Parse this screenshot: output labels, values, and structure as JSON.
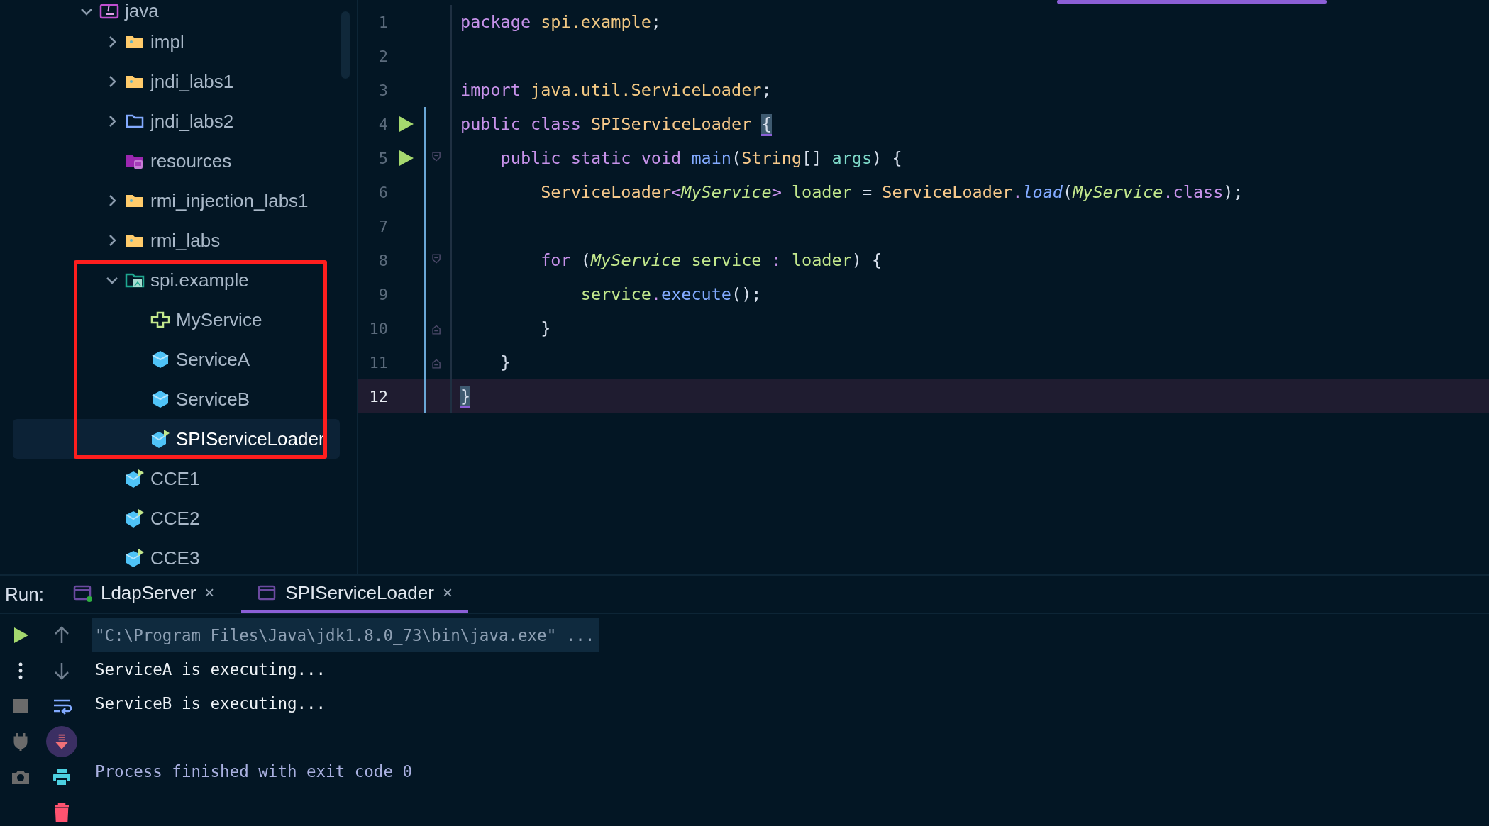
{
  "project_tree": {
    "items": [
      {
        "label": "java",
        "kind": "java-root",
        "expanded": true,
        "children": [
          {
            "label": "impl",
            "kind": "folder",
            "expanded": false
          },
          {
            "label": "jndi_labs1",
            "kind": "folder",
            "expanded": false
          },
          {
            "label": "jndi_labs2",
            "kind": "source-folder",
            "expanded": false
          },
          {
            "label": "resources",
            "kind": "resources"
          },
          {
            "label": "rmi_injection_labs1",
            "kind": "folder",
            "expanded": false
          },
          {
            "label": "rmi_labs",
            "kind": "folder",
            "expanded": false
          },
          {
            "label": "spi.example",
            "kind": "package",
            "expanded": true,
            "highlighted": true,
            "children": [
              {
                "label": "MyService",
                "kind": "interface",
                "selected": false
              },
              {
                "label": "ServiceA",
                "kind": "class",
                "selected": false
              },
              {
                "label": "ServiceB",
                "kind": "class",
                "selected": false
              },
              {
                "label": "SPIServiceLoader",
                "kind": "main-class",
                "selected": true
              }
            ]
          },
          {
            "label": "CCE1",
            "kind": "main-class",
            "selected": false
          },
          {
            "label": "CCE2",
            "kind": "main-class",
            "selected": false
          },
          {
            "label": "CCE3",
            "kind": "main-class",
            "selected": false
          }
        ]
      }
    ]
  },
  "editor": {
    "lines": [
      {
        "number": "1",
        "changed": false,
        "current": false,
        "tokens": [
          {
            "t": "package",
            "kind": "kw"
          },
          {
            "t": " spi.example",
            "kind": "pkg"
          },
          {
            "t": ";",
            "kind": "p"
          }
        ]
      },
      {
        "number": "2",
        "changed": false,
        "current": false
      },
      {
        "number": "3",
        "changed": false,
        "current": false,
        "tokens": [
          {
            "t": "import",
            "kind": "kw"
          },
          {
            "t": " java.util.ServiceLoader",
            "kind": "pkg"
          },
          {
            "t": ";",
            "kind": "p"
          }
        ]
      },
      {
        "number": "4",
        "changed": true,
        "current": false,
        "gutter": [
          {
            "kind": "run"
          }
        ],
        "tokens": [
          {
            "t": "public class",
            "kind": "kw"
          },
          {
            "t": " SPIServiceLoader ",
            "kind": "cls"
          },
          {
            "t": "{",
            "kind": "p",
            "matched": true
          }
        ]
      },
      {
        "number": "5",
        "changed": true,
        "current": false,
        "gutter": [
          {
            "kind": "run"
          },
          {
            "kind": "fold-start"
          }
        ],
        "tokens": [
          {
            "t": "    public static void",
            "kind": "kw"
          },
          {
            "t": " main",
            "kind": "fn"
          },
          {
            "t": "(",
            "kind": "p"
          },
          {
            "t": "String",
            "kind": "cls"
          },
          {
            "t": "[] ",
            "kind": "p"
          },
          {
            "t": "args",
            "kind": "param"
          },
          {
            "t": ") {",
            "kind": "p"
          }
        ]
      },
      {
        "number": "6",
        "changed": true,
        "current": false,
        "tokens": [
          {
            "t": "        ServiceLoader",
            "kind": "cls"
          },
          {
            "t": "<",
            "kind": "op"
          },
          {
            "t": "MyService",
            "kind": "iface"
          },
          {
            "t": ">",
            "kind": "op"
          },
          {
            "t": " loader",
            "kind": "var"
          },
          {
            "t": " = ",
            "kind": "p"
          },
          {
            "t": "ServiceLoader",
            "kind": "cls"
          },
          {
            "t": ".",
            "kind": "op"
          },
          {
            "t": "load",
            "kind": "static"
          },
          {
            "t": "(",
            "kind": "p"
          },
          {
            "t": "MyService",
            "kind": "iface"
          },
          {
            "t": ".class",
            "kind": "kw"
          },
          {
            "t": ");",
            "kind": "p"
          }
        ]
      },
      {
        "number": "7",
        "changed": true,
        "current": false
      },
      {
        "number": "8",
        "changed": true,
        "current": false,
        "gutter": [
          {
            "kind": "fold-start"
          }
        ],
        "tokens": [
          {
            "t": "        for",
            "kind": "kw"
          },
          {
            "t": " (",
            "kind": "p"
          },
          {
            "t": "MyService",
            "kind": "iface"
          },
          {
            "t": " service",
            "kind": "var"
          },
          {
            "t": " :",
            "kind": "op"
          },
          {
            "t": " loader",
            "kind": "var"
          },
          {
            "t": ") {",
            "kind": "p"
          }
        ]
      },
      {
        "number": "9",
        "changed": true,
        "current": false,
        "tokens": [
          {
            "t": "            service",
            "kind": "var"
          },
          {
            "t": ".",
            "kind": "op"
          },
          {
            "t": "execute",
            "kind": "fn"
          },
          {
            "t": "();",
            "kind": "p"
          }
        ]
      },
      {
        "number": "10",
        "changed": true,
        "current": false,
        "gutter": [
          {
            "kind": "fold-end"
          }
        ],
        "tokens": [
          {
            "t": "        }",
            "kind": "p"
          }
        ]
      },
      {
        "number": "11",
        "changed": true,
        "current": false,
        "gutter": [
          {
            "kind": "fold-end"
          }
        ],
        "tokens": [
          {
            "t": "    }",
            "kind": "p"
          }
        ]
      },
      {
        "number": "12",
        "changed": true,
        "current": true,
        "tokens": [
          {
            "t": "}",
            "kind": "p",
            "matched": true
          }
        ]
      }
    ]
  },
  "run_panel": {
    "label": "Run:",
    "tabs": [
      {
        "label": "LdapServer",
        "close": "×",
        "selected": false,
        "running": true
      },
      {
        "label": "SPIServiceLoader",
        "close": "×",
        "selected": true,
        "running": false
      }
    ],
    "scroll_to_end_on": true,
    "console": [
      {
        "text": "\"C:\\Program Files\\Java\\jdk1.8.0_73\\bin\\java.exe\" ...",
        "kind": "command"
      },
      {
        "text": "ServiceA is executing...",
        "kind": "output"
      },
      {
        "text": "ServiceB is executing...",
        "kind": "output"
      },
      {
        "text": "Process finished with exit code 0",
        "kind": "info"
      }
    ]
  }
}
